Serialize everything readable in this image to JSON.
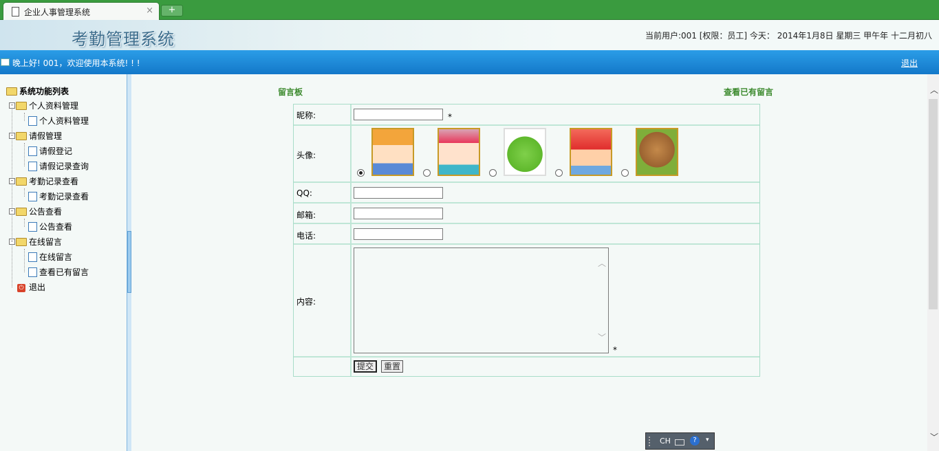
{
  "browser": {
    "tab_title": "企业人事管理系统",
    "close_glyph": "×",
    "new_tab_glyph": "+"
  },
  "header": {
    "system_title": "考勤管理系统",
    "user_info": "当前用户:001 [权限：员工] 今天： 2014年1月8日 星期三 甲午年 十二月初八"
  },
  "welcome_bar": {
    "greeting": "晚上好! 001，欢迎使用本系统! ! !",
    "logout_label": "退出"
  },
  "sidebar": {
    "root_label": "系统功能列表",
    "groups": [
      {
        "label": "个人资料管理",
        "children": [
          "个人资料管理"
        ]
      },
      {
        "label": "请假管理",
        "children": [
          "请假登记",
          "请假记录查询"
        ]
      },
      {
        "label": "考勤记录查看",
        "children": [
          "考勤记录查看"
        ]
      },
      {
        "label": "公告查看",
        "children": [
          "公告查看"
        ]
      },
      {
        "label": "在线留言",
        "children": [
          "在线留言",
          "查看已有留言"
        ]
      }
    ],
    "exit_label": "退出"
  },
  "main": {
    "board_label": "留言板",
    "view_messages_link": "查看已有留言",
    "form": {
      "nickname_label": "昵称:",
      "nickname_value": "",
      "required_mark": "*",
      "avatar_label": "头像:",
      "avatars": [
        {
          "name": "girl-avatar",
          "selected": true
        },
        {
          "name": "pink-girl-avatar",
          "selected": false
        },
        {
          "name": "frog-avatar",
          "selected": false
        },
        {
          "name": "red-hood-avatar",
          "selected": false
        },
        {
          "name": "bear-avatar",
          "selected": false
        }
      ],
      "qq_label": "QQ:",
      "qq_value": "",
      "email_label": "邮箱:",
      "email_value": "",
      "phone_label": "电话:",
      "phone_value": "",
      "content_label": "内容:",
      "content_value": "",
      "submit_label": "提交",
      "reset_label": "重置"
    }
  },
  "ime": {
    "lang": "CH",
    "help": "?"
  },
  "colors": {
    "tab_bar": "#3a9b3f",
    "welcome_bar": "#1378c9",
    "label_green": "#3c8a2e",
    "table_border": "#bfe6d6"
  }
}
